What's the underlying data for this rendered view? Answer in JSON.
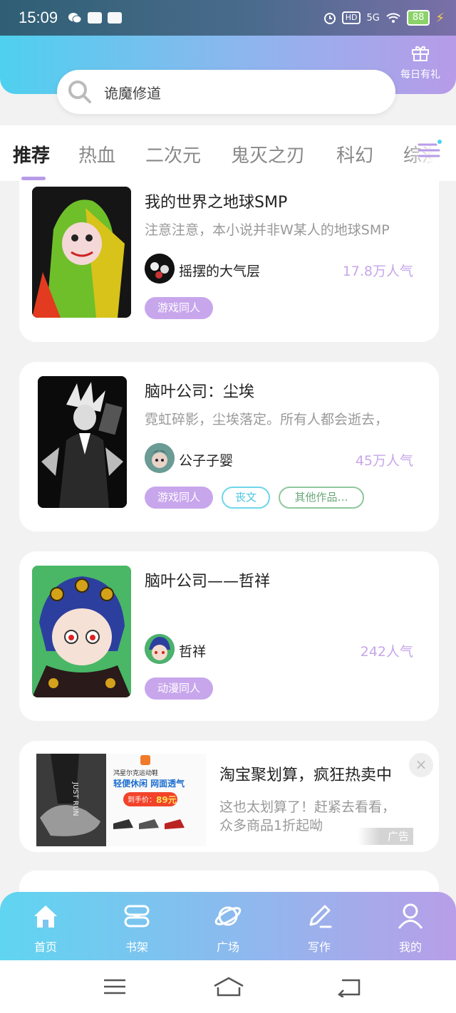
{
  "status_bar": {
    "time": "15:09",
    "hd": "HD",
    "network": "5G",
    "battery": "88"
  },
  "header": {
    "gift_label": "每日有礼",
    "search_text": "诡魔修道"
  },
  "tabs": [
    {
      "label": "推荐",
      "active": true
    },
    {
      "label": "热血",
      "active": false
    },
    {
      "label": "二次元",
      "active": false
    },
    {
      "label": "鬼灭之刃",
      "active": false
    },
    {
      "label": "科幻",
      "active": false
    },
    {
      "label": "综漫",
      "active": false
    }
  ],
  "books": [
    {
      "title": "我的世界之地球SMP",
      "description": "注意注意，本小说并非W某人的地球SMP",
      "author": "摇摆的大气层",
      "popularity": "17.8万人气",
      "tags": [
        "游戏同人"
      ]
    },
    {
      "title": "脑叶公司：尘埃",
      "description": "霓虹碎影，尘埃落定。所有人都会逝去，",
      "author": "公子子婴",
      "popularity": "45万人气",
      "tags": [
        "游戏同人",
        "丧文",
        "其他作品…"
      ]
    },
    {
      "title": "脑叶公司——哲祥",
      "description": "",
      "author": "哲祥",
      "popularity": "242人气",
      "tags": [
        "动漫同人"
      ]
    }
  ],
  "ad": {
    "title": "淘宝聚划算，疯狂热卖中",
    "description": "这也太划算了！赶紧去看看，众多商品1折起呦",
    "badge": "广告",
    "close": "×",
    "image_text": {
      "brand": "鸿星尔克运动鞋",
      "headline": "轻便休闲 网面透气",
      "price_label": "到手价：",
      "price": "89元",
      "side_text": "JUST RUN"
    }
  },
  "bottom_nav": [
    {
      "label": "首页",
      "icon": "home-icon",
      "active": true
    },
    {
      "label": "书架",
      "icon": "bookshelf-icon",
      "active": false
    },
    {
      "label": "广场",
      "icon": "planet-icon",
      "active": false
    },
    {
      "label": "写作",
      "icon": "pen-icon",
      "active": false
    },
    {
      "label": "我的",
      "icon": "user-icon",
      "active": false
    }
  ],
  "colors": {
    "accent_purple": "#c8a6ec",
    "accent_cyan": "#4fd0ef",
    "popularity": "#c7a7ea"
  }
}
